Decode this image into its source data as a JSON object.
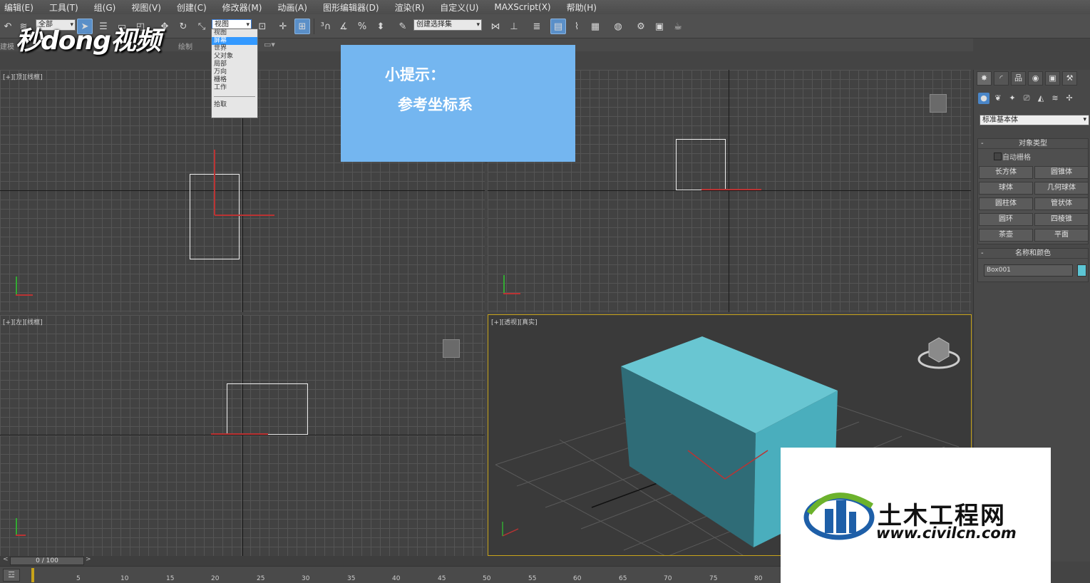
{
  "menubar": {
    "items": [
      "编辑(E)",
      "工具(T)",
      "组(G)",
      "视图(V)",
      "创建(C)",
      "修改器(M)",
      "动画(A)",
      "图形编辑器(D)",
      "渲染(R)",
      "自定义(U)",
      "MAXScript(X)",
      "帮助(H)"
    ]
  },
  "toolbar": {
    "selection_filter": "全部",
    "ref_coord_value": "视图",
    "named_selection": "创建选择集",
    "watermark_logo": "秒dong视频"
  },
  "toolbar2": {
    "left_text": "建模",
    "mid_text": "绘制"
  },
  "ref_coord_dropdown": {
    "options": [
      "视图",
      "屏幕",
      "世界",
      "父对象",
      "局部",
      "万向",
      "栅格",
      "工作"
    ],
    "selected_index": 1,
    "pick_label": "拾取"
  },
  "tip": {
    "title": "小提示：",
    "subtitle": "参考坐标系"
  },
  "viewports": {
    "top_left_label": "[+][顶][线框]",
    "top_right_label": "",
    "bottom_left_label": "[+][左][线框]",
    "bottom_right_label": "[+][透视][真实]"
  },
  "command_panel": {
    "tab_icons": [
      "create-icon",
      "modify-icon",
      "hierarchy-icon",
      "motion-icon",
      "display-icon",
      "utilities-icon"
    ],
    "sub_icons": [
      "geometry-icon",
      "shapes-icon",
      "lights-icon",
      "cameras-icon",
      "helpers-icon",
      "spacewarps-icon",
      "systems-icon"
    ],
    "category": "标准基本体",
    "object_type_header": "对象类型",
    "autogrid_label": "自动栅格",
    "buttons": [
      "长方体",
      "圆锥体",
      "球体",
      "几何球体",
      "圆柱体",
      "管状体",
      "圆环",
      "四棱锥",
      "茶壶",
      "平面"
    ],
    "name_color_header": "名称和颜色",
    "object_name": "Box001",
    "object_color": "#5cc5d4"
  },
  "timeline": {
    "frame_display": "0 / 100",
    "ruler_numbers": [
      "5",
      "10",
      "15",
      "20",
      "25",
      "30",
      "35",
      "40",
      "45",
      "50",
      "55",
      "60",
      "65",
      "70",
      "75",
      "80"
    ]
  },
  "watermark": {
    "title": "土木工程网",
    "url": "www.civilcn.com"
  }
}
